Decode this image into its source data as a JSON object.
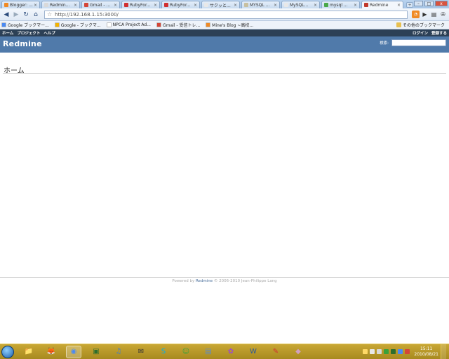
{
  "browser": {
    "tabs": [
      {
        "label": "Blogger: ...",
        "color": "#f08a24"
      },
      {
        "label": "Redmin...",
        "color": "#d9d9d9"
      },
      {
        "label": "Gmail - ...",
        "color": "#d44638"
      },
      {
        "label": "RubyFor...",
        "color": "#d03030"
      },
      {
        "label": "RubyFor...",
        "color": "#d03030"
      },
      {
        "label": "サクッと...",
        "color": "#e8e8e8"
      },
      {
        "label": "MYSQL ...",
        "color": "#c8c0a0"
      },
      {
        "label": "MySQL...",
        "color": "#e8e8e8"
      },
      {
        "label": "mysql ...",
        "color": "#4aa84a"
      },
      {
        "label": "Redmine",
        "color": "#c0392b",
        "active": true
      }
    ],
    "tab_close_glyph": "×",
    "new_tab_glyph": "+",
    "window_controls": {
      "minimize": "–",
      "maximize": "□",
      "close": "x"
    },
    "url": "http://192.168.1.15:3000/",
    "bookmarks": [
      {
        "label": "Google ブックマー...",
        "color": "#4a8af4"
      },
      {
        "label": "Google - ブックマ...",
        "color": "#f4b400"
      },
      {
        "label": "NPCA Project Ad...",
        "color": "#ffffff"
      },
      {
        "label": "Gmail - 受信トレ...",
        "color": "#d44638"
      },
      {
        "label": "Mine's Blog ~高校...",
        "color": "#f08a24"
      }
    ],
    "bookmarks_other": "その他のブックマーク"
  },
  "redmine": {
    "top_menu": {
      "home": "ホーム",
      "projects": "プロジェクト",
      "help": "ヘルプ",
      "login": "ログイン",
      "register": "登録する"
    },
    "app_title": "Redmine",
    "search_label": "検索:",
    "search_value": "",
    "page_title": "ホーム",
    "footer": {
      "powered_by": "Powered by ",
      "link": "Redmine",
      "copyright": " © 2006-2010 Jean-Philippe Lang"
    }
  },
  "taskbar": {
    "apps": [
      {
        "name": "explorer",
        "glyph": "📁",
        "color": "#e8c050"
      },
      {
        "name": "firefox",
        "glyph": "🦊",
        "color": "#e66000"
      },
      {
        "name": "chrome",
        "glyph": "◉",
        "color": "#4a8af4",
        "active": true
      },
      {
        "name": "app-4",
        "glyph": "▣",
        "color": "#2d6e2d"
      },
      {
        "name": "itunes",
        "glyph": "♫",
        "color": "#3a7bd5"
      },
      {
        "name": "app-6",
        "glyph": "✉",
        "color": "#333333"
      },
      {
        "name": "skype",
        "glyph": "S",
        "color": "#00aff0"
      },
      {
        "name": "messenger",
        "glyph": "☺",
        "color": "#3aa13a"
      },
      {
        "name": "app-9",
        "glyph": "▤",
        "color": "#5a8ad0"
      },
      {
        "name": "picasa",
        "glyph": "✿",
        "color": "#9c4ad0"
      },
      {
        "name": "word",
        "glyph": "W",
        "color": "#2b579a"
      },
      {
        "name": "app-12",
        "glyph": "✎",
        "color": "#d03030"
      },
      {
        "name": "app-13",
        "glyph": "◆",
        "color": "#d0a0c0"
      }
    ],
    "time": "15:11",
    "date": "2010/08/21"
  }
}
